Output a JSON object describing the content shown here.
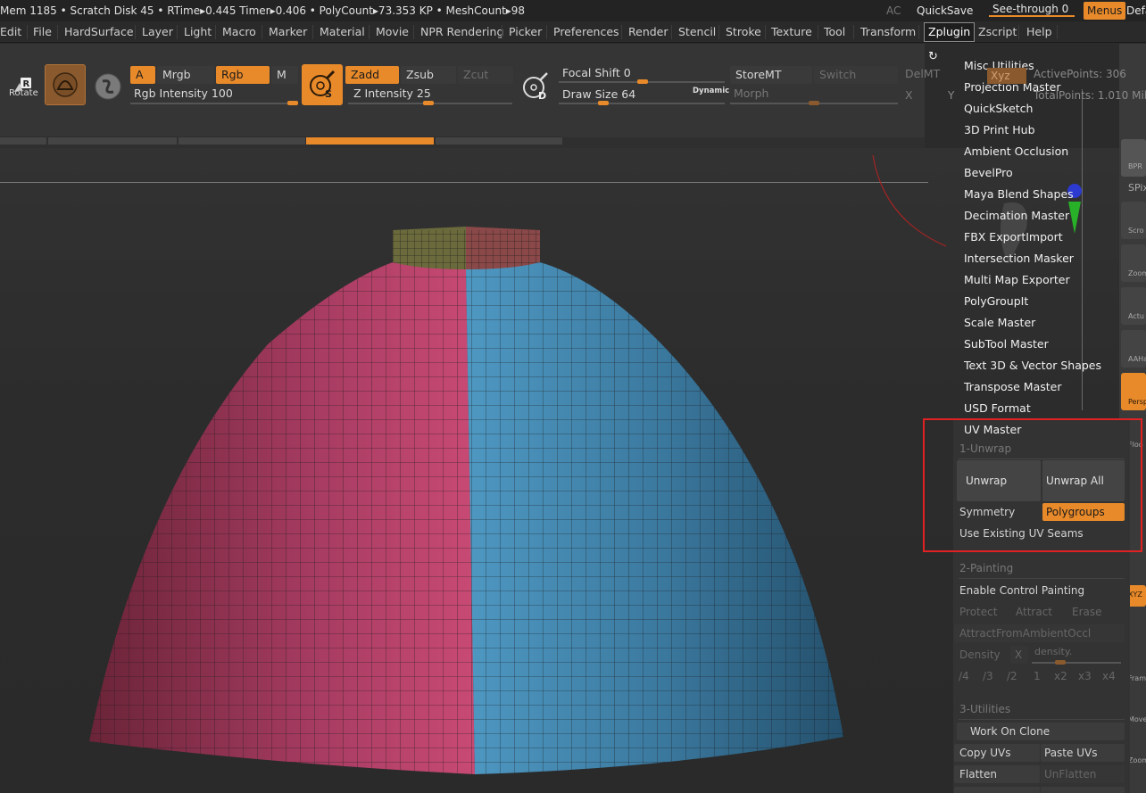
{
  "status": {
    "stats": "Mem 1185 • Scratch Disk 45 •  RTime▸0.445 Timer▸0.406 • PolyCount▸73.353 KP  • MeshCount▸98",
    "ac": "AC",
    "quicksave": "QuickSave",
    "see_through": "See-through  0",
    "menus": "Menus",
    "default": "Defa"
  },
  "menubar": [
    "Edit",
    "File",
    "HardSurface",
    "Layer",
    "Light",
    "Macro",
    "Marker",
    "Material",
    "Movie",
    "NPR Rendering",
    "Picker",
    "Preferences",
    "Render",
    "Stencil",
    "Stroke",
    "Texture",
    "Tool",
    "Transform",
    "Zplugin",
    "Zscript",
    "Help"
  ],
  "menubar_active": "Zplugin",
  "toolbar": {
    "rotate": "Rotate",
    "a": "A",
    "mrgb": "Mrgb",
    "rgb": "Rgb",
    "m": "M",
    "rgb_intensity": "Rgb Intensity 100",
    "zadd": "Zadd",
    "zsub": "Zsub",
    "zcut": "Zcut",
    "z_intensity": "Z Intensity 25",
    "focal_shift": "Focal Shift 0",
    "draw_size": "Draw Size 64",
    "dynamic": "Dynamic",
    "storemt": "StoreMT",
    "switch": "Switch",
    "delmt": "DelMT",
    "morph": "Morph",
    "xyz": "Xyz",
    "active_points": "ActivePoints: 306",
    "total_points": "TotalPoints: 1.010 Mil",
    "x_label": "X",
    "y_label": "Y",
    "brush_s": "S",
    "brush_d": "D"
  },
  "zplugin_menu": {
    "items": [
      "Misc Utilities",
      "Projection Master",
      "QuickSketch",
      "3D Print Hub",
      "Ambient Occlusion",
      "BevelPro",
      "Maya Blend Shapes",
      "Decimation Master",
      "FBX ExportImport",
      "Intersection Masker",
      "Multi Map Exporter",
      "PolyGroupIt",
      "Scale Master",
      "SubTool Master",
      "Text 3D & Vector Shapes",
      "Transpose Master",
      "USD Format"
    ],
    "uv_master": {
      "title": "UV Master",
      "section1": "1-Unwrap",
      "unwrap": "Unwrap",
      "unwrap_all": "Unwrap All",
      "symmetry": "Symmetry",
      "polygroups": "Polygroups",
      "use_existing_seams": "Use Existing UV Seams",
      "section2": "2-Painting",
      "enable_control_painting": "Enable Control Painting",
      "protect": "Protect",
      "attract": "Attract",
      "erase": "Erase",
      "attract_from_ao": "AttractFromAmbientOccl",
      "density": "Density",
      "density_x": "X",
      "density_slider": "density.",
      "density_values": [
        "/4",
        "/3",
        "/2",
        "1",
        "x2",
        "x3",
        "x4"
      ],
      "section3": "3-Utilities",
      "work_on_clone": "Work On Clone",
      "copy_uvs": "Copy UVs",
      "paste_uvs": "Paste UVs",
      "flatten": "Flatten",
      "unflatten": "UnFlatten"
    }
  },
  "right_shelf": [
    "BPR",
    "SPix",
    "Scro",
    "Zoom",
    "Actu",
    "AAHa",
    "Persp",
    "Floo",
    "XYZ",
    "Fram",
    "Move",
    "Zoom"
  ],
  "colors": {
    "accent": "#e88a2a",
    "highlight": "#e02222",
    "mesh_left": "#c04870",
    "mesh_right": "#4a8ab0"
  }
}
